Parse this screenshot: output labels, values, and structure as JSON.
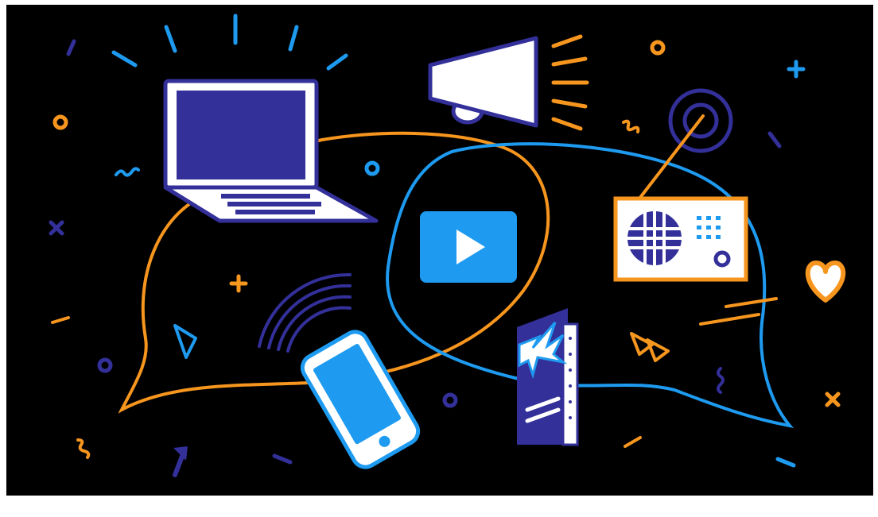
{
  "illustration": {
    "subject": "media-and-communication",
    "colors": {
      "background": "#000000",
      "orange": "#F7961E",
      "blue": "#1E9BF0",
      "indigo": "#33309A",
      "white": "#FFFFFF"
    },
    "icons": [
      "laptop-icon",
      "megaphone-icon",
      "video-play-icon",
      "radio-icon",
      "smartphone-icon",
      "brochure-icon",
      "heart-icon",
      "cursor-arrow-icon",
      "signal-waves-icon",
      "broadcast-target-icon"
    ]
  }
}
